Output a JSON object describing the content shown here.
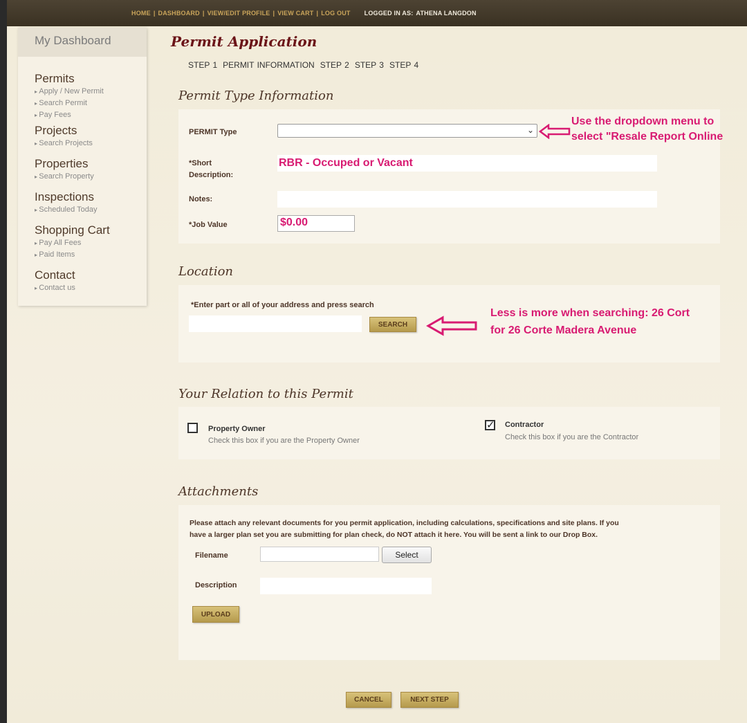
{
  "topbar": {
    "home": "HOME",
    "dashboard": "DASHBOARD",
    "view_edit_profile": "VIEW/EDIT PROFILE",
    "view_cart": "VIEW CART",
    "log_out": "LOG OUT",
    "logged_in_label": "LOGGED IN AS:",
    "user_name": "ATHENA LANGDON",
    "separator": "|"
  },
  "sidebar": {
    "heading": "My Dashboard",
    "sections": [
      {
        "title": "Permits",
        "items": [
          "Apply / New Permit",
          "Search Permit",
          "Pay Fees"
        ]
      },
      {
        "title": "Projects",
        "items": [
          "Search Projects"
        ]
      },
      {
        "title": "Properties",
        "items": [
          "Search Property"
        ]
      },
      {
        "title": "Inspections",
        "items": [
          "Scheduled Today"
        ]
      },
      {
        "title": "Shopping Cart",
        "items": [
          "Pay All Fees",
          "Paid Items"
        ]
      },
      {
        "title": "Contact",
        "items": [
          "Contact us"
        ]
      }
    ]
  },
  "page": {
    "title": "Permit Application",
    "steps": [
      "STEP 1",
      "PERMIT INFORMATION",
      "STEP 2",
      "STEP 3",
      "STEP 4"
    ]
  },
  "permit_type": {
    "section_title": "Permit Type Information",
    "permit_type_label": "PERMIT Type",
    "permit_type_value": "",
    "short_desc_label_1": "*Short",
    "short_desc_label_2": "Description:",
    "short_desc_value": "RBR - Occuped or Vacant",
    "notes_label": "Notes:",
    "notes_value": "",
    "job_value_label": "*Job Value",
    "job_value_value": "$0.00"
  },
  "location": {
    "section_title": "Location",
    "instruction": "*Enter part or all of your address and press search",
    "search_value": "",
    "search_button": "SEARCH"
  },
  "relation": {
    "section_title": "Your Relation to this Permit",
    "owner_label": "Property Owner",
    "owner_help": "Check this box if you are the Property Owner",
    "owner_checked": false,
    "contractor_label": "Contractor",
    "contractor_help": "Check this box if you are the Contractor",
    "contractor_checked": true
  },
  "attachments": {
    "section_title": "Attachments",
    "instructions_1": "Please attach any relevant documents for you permit application, including calculations, specifications and site plans.  If you",
    "instructions_2": "have a larger plan set you are submitting for plan check, do NOT attach it here.  You will be sent a link to our Drop Box.",
    "filename_label": "Filename",
    "filename_value": "",
    "select_button": "Select",
    "description_label": "Description",
    "description_value": "",
    "upload_button": "UPLOAD"
  },
  "footer": {
    "cancel_button": "CANCEL",
    "next_button": "NEXT STEP"
  },
  "annotations": {
    "dropdown_1": "Use the dropdown menu to",
    "dropdown_2": "select \"Resale Report Online",
    "search_1": "Less is more when searching: 26 Cort",
    "search_2": "for 26 Corte Madera Avenue"
  },
  "colors": {
    "accent_maroon": "#6b1418",
    "annotation_pink": "#d81b72",
    "button_gold": "#c9ad5e",
    "topbar_brown": "#433a2a"
  }
}
